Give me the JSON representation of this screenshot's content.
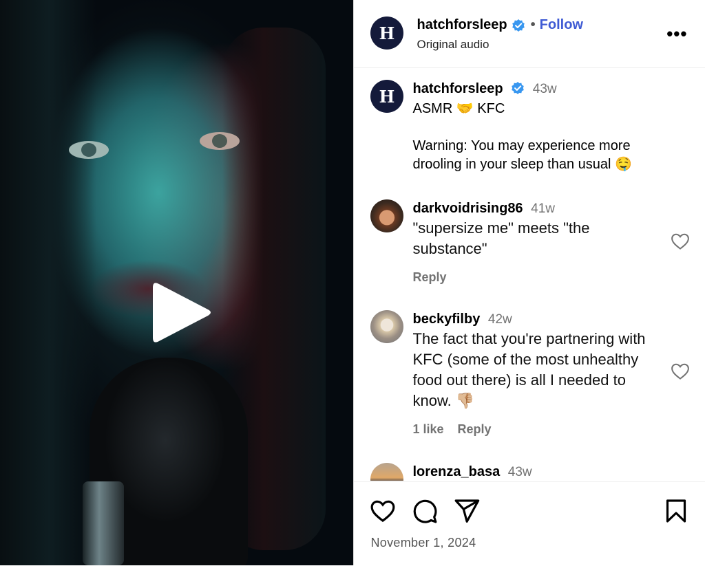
{
  "post": {
    "username": "hatchforsleep",
    "follow_label": "Follow",
    "dot": "•",
    "audio_label": "Original audio",
    "more_label": "•••",
    "brand_initial": "H",
    "date": "November 1, 2024"
  },
  "caption": {
    "username": "hatchforsleep",
    "time": "43w",
    "line1": "ASMR 🤝 KFC",
    "line2": "Warning: You may experience more drooling in your sleep than usual 🤤"
  },
  "comments": [
    {
      "username": "darkvoidrising86",
      "time": "41w",
      "text": "\"supersize me\" meets \"the substance\"",
      "reply_label": "Reply"
    },
    {
      "username": "beckyfilby",
      "time": "42w",
      "text": "The fact that you're partnering with KFC (some of the most unhealthy food out there) is all I needed to know. 👎🏼",
      "likes_label": "1 like",
      "reply_label": "Reply"
    },
    {
      "username": "lorenza_basa",
      "time": "43w"
    }
  ],
  "icons": {
    "verified": "verified-badge-icon",
    "more": "more-options-icon",
    "play": "play-icon",
    "heart": "heart-icon",
    "comment": "comment-icon",
    "share": "share-icon",
    "save": "bookmark-icon"
  },
  "colors": {
    "follow": "#3f5bd4",
    "verified": "#3897f0",
    "brand_avatar": "#141a3a"
  }
}
